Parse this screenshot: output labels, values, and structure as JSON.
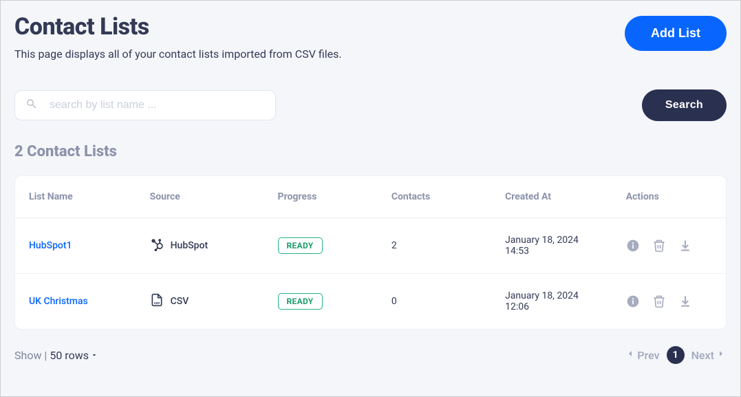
{
  "header": {
    "title": "Contact Lists",
    "subtitle": "This page displays all of your contact lists imported from CSV files.",
    "add_list_label": "Add List"
  },
  "search": {
    "placeholder": "search by list name ...",
    "button_label": "Search"
  },
  "count_title": "2 Contact Lists",
  "table": {
    "columns": {
      "name": "List Name",
      "source": "Source",
      "progress": "Progress",
      "contacts": "Contacts",
      "created": "Created At",
      "actions": "Actions"
    },
    "rows": [
      {
        "name": "HubSpot1",
        "source": "HubSpot",
        "source_type": "hubspot",
        "progress": "READY",
        "contacts": "2",
        "created": "January 18, 2024 14:53"
      },
      {
        "name": "UK Christmas",
        "source": "CSV",
        "source_type": "csv",
        "progress": "READY",
        "contacts": "0",
        "created": "January 18, 2024 12:06"
      }
    ]
  },
  "footer": {
    "show_label": "Show |",
    "rows_value": "50 rows",
    "prev_label": "Prev",
    "next_label": "Next",
    "current_page": "1"
  }
}
